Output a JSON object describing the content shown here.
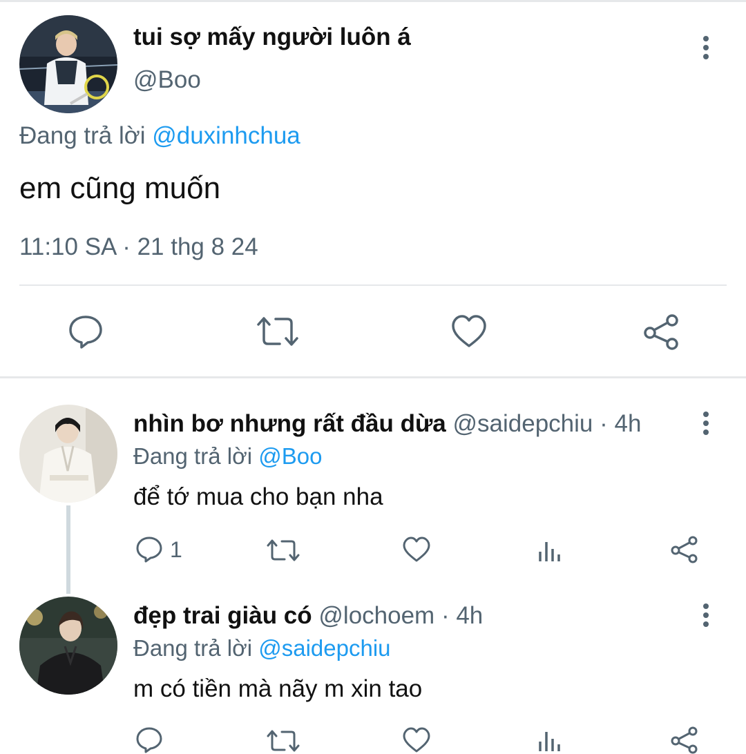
{
  "main_tweet": {
    "display_name": "tui sợ mấy người luôn á",
    "handle": "@Boo",
    "replying_prefix": "Đang trả lời",
    "replying_to": "@duxinhchua",
    "text": "em cũng muốn",
    "timestamp": "11:10 SA · 21 thg 8 24",
    "actions": [
      "reply-icon",
      "retweet-icon",
      "like-icon",
      "share-icon"
    ]
  },
  "replies": [
    {
      "display_name": "nhìn bơ nhưng rất đầu dừa",
      "handle": "@saidepchiu",
      "age": "· 4h",
      "replying_prefix": "Đang trả lời",
      "replying_to": "@Boo",
      "text": "để tớ mua cho bạn nha",
      "reply_count": "1"
    },
    {
      "display_name": "đẹp trai giàu có",
      "handle": "@lochoem",
      "age": "· 4h",
      "replying_prefix": "Đang trả lời",
      "replying_to": "@saidepchiu",
      "text": "m có tiền mà nãy m xin tao"
    }
  ],
  "colors": {
    "accent": "#1d9bf0",
    "secondary_text": "#536471",
    "divider": "#e6e8ea"
  }
}
